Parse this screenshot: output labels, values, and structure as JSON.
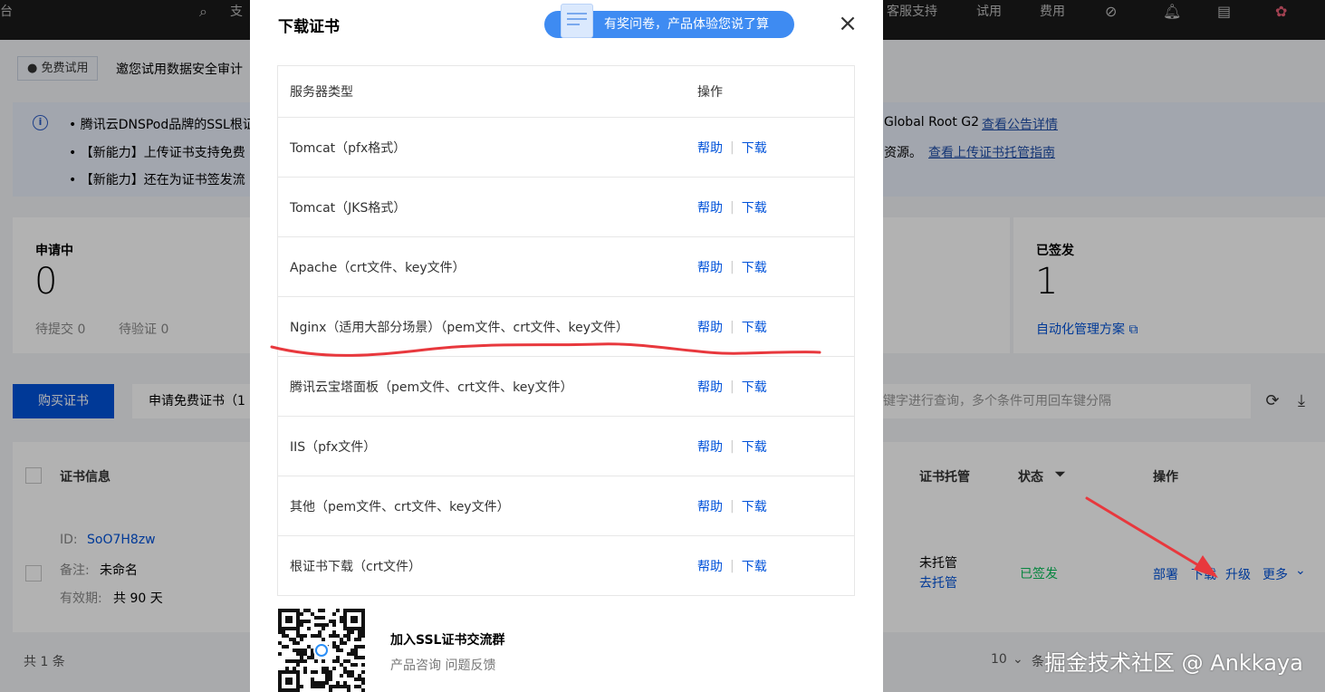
{
  "topbar": {
    "left_label": "台",
    "search_label": "支",
    "support_label": "客服支持",
    "trial_label": "试用",
    "cost_label": "费用"
  },
  "trial_banner": {
    "badge": "● 免费试用",
    "text": "邀您试用数据安全审计"
  },
  "info": {
    "line1_text": "• 腾讯云DNSPod品牌的SSL根证",
    "line1_right": "Global Root G2",
    "line1_link": "查看公告详情",
    "line2_text": "• 【新能力】上传证书支持免费",
    "line2_right": "资源。",
    "line2_link": "查看上传证书托管指南",
    "line3_text": "• 【新能力】还在为证书签发流"
  },
  "stats": {
    "applying": {
      "title": "申请中",
      "value": "0",
      "sub1": "待提交 0",
      "sub2": "待验证 0"
    },
    "issued": {
      "title": "已签发",
      "value": "1",
      "link": "自动化管理方案 ⧉"
    }
  },
  "toolbar": {
    "buy_label": "购买证书",
    "free_label": "申请免费证书（1",
    "search_placeholder": "键字进行查询，多个条件可用回车键分隔"
  },
  "cert_table": {
    "headers": {
      "info": "证书信息",
      "hosting": "证书托管",
      "status": "状态",
      "ops": "操作"
    },
    "row": {
      "id_label": "ID:",
      "id_value": "SoO7H8zw",
      "note_label": "备注:",
      "note_value": "未命名",
      "validity_label": "有效期:",
      "validity_value": "共 90 天",
      "hosting": "未托管",
      "hosting_link": "去托管",
      "status": "已签发",
      "op_deploy": "部署",
      "op_download": "下载",
      "op_upgrade": "升级",
      "op_more": "更多"
    },
    "total": "共 1 条",
    "page_size": "10",
    "page_size_suffix": "条"
  },
  "modal": {
    "title": "下载证书",
    "survey_text": "有奖问卷，产品体验您说了算",
    "close": "×",
    "header_server": "服务器类型",
    "header_action": "操作",
    "help_label": "帮助",
    "download_label": "下载",
    "separator": "|",
    "rows": [
      {
        "name": "Tomcat（pfx格式）"
      },
      {
        "name": "Tomcat（JKS格式）"
      },
      {
        "name": "Apache（crt文件、key文件）"
      },
      {
        "name": "Nginx（适用大部分场景）（pem文件、crt文件、key文件）"
      },
      {
        "name": "腾讯云宝塔面板（pem文件、crt文件、key文件）"
      },
      {
        "name": "IIS（pfx文件）"
      },
      {
        "name": "其他（pem文件、crt文件、key文件）"
      },
      {
        "name": "根证书下载（crt文件）"
      }
    ],
    "qr_title": "加入SSL证书交流群",
    "qr_sub": "产品咨询 问题反馈"
  },
  "watermark": "掘金技术社区 @ Ankkaya",
  "colors": {
    "primary": "#0052d9",
    "success": "#0abf5b",
    "annotation_red": "#e8383d"
  }
}
